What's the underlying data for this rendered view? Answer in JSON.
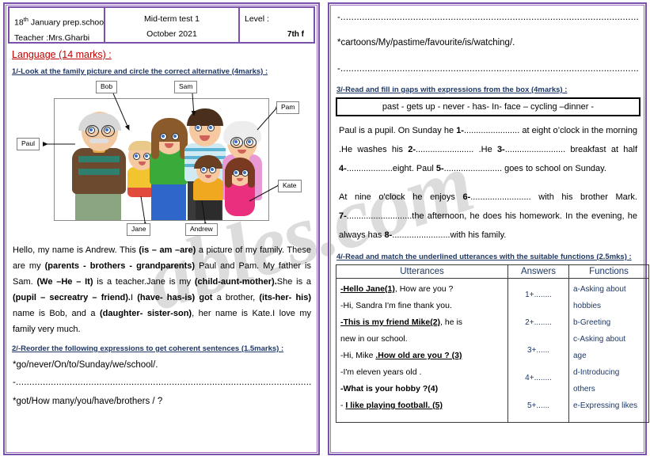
{
  "watermark": "ables.com",
  "header": {
    "school": "18",
    "school_sup": "th",
    "school_rest": " January prep.school",
    "teacher": "Teacher :Mrs.Gharbi",
    "test_title": "Mid-term test 1",
    "test_date": "October 2021",
    "level_label": "Level :",
    "level_value": "7th f"
  },
  "left": {
    "section_title": "Language (14 marks) :",
    "ex1_heading": "1/-Look at the family picture and circle the correct alternative (4marks) :",
    "picture_tags": {
      "bob": "Bob",
      "sam": "Sam",
      "pam": "Pam",
      "paul": "Paul",
      "kate": "Kate",
      "jane": "Jane",
      "andrew": "Andrew"
    },
    "passage": [
      {
        "t": "Hello, my name is Andrew. This ",
        "b": false
      },
      {
        "t": "(is – am –are)",
        "b": true
      },
      {
        "t": " a picture of my family. These are my ",
        "b": false
      },
      {
        "t": "(parents - brothers - grandparents)",
        "b": true
      },
      {
        "t": " Paul and Pam. My father is Sam. ",
        "b": false
      },
      {
        "t": "(We –He –  It)",
        "b": true
      },
      {
        "t": " is a teacher.Jane is my ",
        "b": false
      },
      {
        "t": "(child-aunt-mother).",
        "b": true
      },
      {
        "t": "She is a ",
        "b": false
      },
      {
        "t": "(pupil – secreatry – friend).",
        "b": true
      },
      {
        "t": "I ",
        "b": false
      },
      {
        "t": "(have- has-is) got",
        "b": true
      },
      {
        "t": " a brother, ",
        "b": false
      },
      {
        "t": "(its-her- his)",
        "b": true
      },
      {
        "t": " name is Bob, and a ",
        "b": false
      },
      {
        "t": "(daughter- sister-son)",
        "b": true
      },
      {
        "t": ", her name is Kate.I love my family very much.",
        "b": false
      }
    ],
    "ex2_heading": "2/-Reorder the following expressions to get coherent sentences (1.5marks) :",
    "ex2_items": [
      "*go/never/On/to/Sunday/we/school/.",
      "-.............................................................................................................. .",
      "*got/How many/you/have/brothers / ?"
    ]
  },
  "right": {
    "top_dots": "-............................................................................................................... .",
    "ex2_item3": "*cartoons/My/pastime/favourite/is/watching/.",
    "ex2_dots3": "-............................................................................................................... .",
    "ex3_heading": "3/-Read and fill in gaps with expressions from the box (4marks) :",
    "wordbox": "past - gets up - never - has- In- face – cycling –dinner -",
    "gapfill_p1": [
      {
        "t": "Paul is a pupil. On Sunday he ",
        "b": false
      },
      {
        "t": "1-",
        "b": true
      },
      {
        "t": "....................... at eight o’clock in the morning .He washes his ",
        "b": false
      },
      {
        "t": "2-",
        "b": true
      },
      {
        "t": "........................ .He ",
        "b": false
      },
      {
        "t": "3-",
        "b": true
      },
      {
        "t": "......................... breakfast at half ",
        "b": false
      },
      {
        "t": "4-",
        "b": true
      },
      {
        "t": "...................eight. Paul ",
        "b": false
      },
      {
        "t": "5-",
        "b": true
      },
      {
        "t": "........................ goes to school on Sunday.",
        "b": false
      }
    ],
    "gapfill_p2": [
      {
        "t": "At nine o'clock he enjoys ",
        "b": false
      },
      {
        "t": "6-",
        "b": true
      },
      {
        "t": "......................... with his brother Mark. ",
        "b": false
      },
      {
        "t": "7-",
        "b": true
      },
      {
        "t": "...........................the afternoon, he does his homework. In the evening, he always has ",
        "b": false
      },
      {
        "t": "8-",
        "b": true
      },
      {
        "t": "........................with his family.",
        "b": false
      }
    ],
    "ex4_heading": "4/-Read and match the underlined utterances with the suitable functions (2.5mks) :",
    "table": {
      "headers": [
        "Utterances",
        "Answers",
        "Functions"
      ],
      "utterances": [
        [
          {
            "t": "-Hello Jane(1)",
            "u": true
          },
          {
            "t": ", How are you ?",
            "u": false
          }
        ],
        [
          {
            "t": "-Hi, Sandra I'm fine thank you.",
            "u": false
          }
        ],
        [
          {
            "t": "-This is my friend Mike(2)",
            "u": true
          },
          {
            "t": ", he is",
            "u": false
          }
        ],
        [
          {
            "t": "new in our school.",
            "u": false
          }
        ],
        [
          {
            "t": "-Hi, Mike ",
            "u": false
          },
          {
            "t": ".How old are you ? (3)",
            "u": true
          }
        ],
        [
          {
            "t": "-I'm eleven years old .",
            "u": false
          }
        ],
        [
          {
            "t": "-What is your hobby ?(4)",
            "u": false,
            "bold": true
          }
        ],
        [
          {
            "t": "- ",
            "u": false
          },
          {
            "t": "I like playing football. (5)",
            "u": true
          }
        ]
      ],
      "answers": [
        "1+........",
        "2+........",
        "3+......",
        "4+........",
        "5+......"
      ],
      "functions": [
        "a-Asking about",
        "hobbies",
        "b-Greeting",
        "c-Asking about",
        "age",
        "d-Introducing",
        "others",
        "e-Expressing likes"
      ]
    }
  },
  "colors": {
    "border_purple": "#7b52ab",
    "heading_red": "#c00000",
    "heading_blue": "#1f3864"
  }
}
